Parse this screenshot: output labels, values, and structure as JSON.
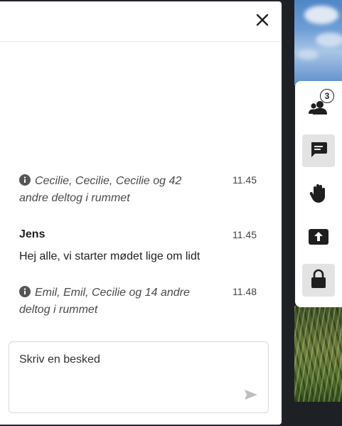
{
  "chat": {
    "messages": [
      {
        "type": "system",
        "text": "Cecilie, Cecilie, Cecilie og 42 andre deltog i rummet",
        "time": "11.45"
      },
      {
        "type": "user",
        "author": "Jens",
        "body": "Hej alle, vi starter mødet lige om lidt",
        "time": "11.45"
      },
      {
        "type": "system",
        "text": "Emil, Emil, Cecilie og 14 andre deltog i rummet",
        "time": "11.48"
      }
    ],
    "composer": {
      "placeholder": "Skriv en besked"
    }
  },
  "toolbar": {
    "participants_count": "3",
    "items": [
      "participants-icon",
      "chat-icon",
      "raise-hand-icon",
      "share-screen-icon",
      "lock-icon"
    ]
  },
  "colors": {
    "panel": "#ffffff",
    "active_tool": "#e3e3e3",
    "icon": "#1f1f1f"
  }
}
